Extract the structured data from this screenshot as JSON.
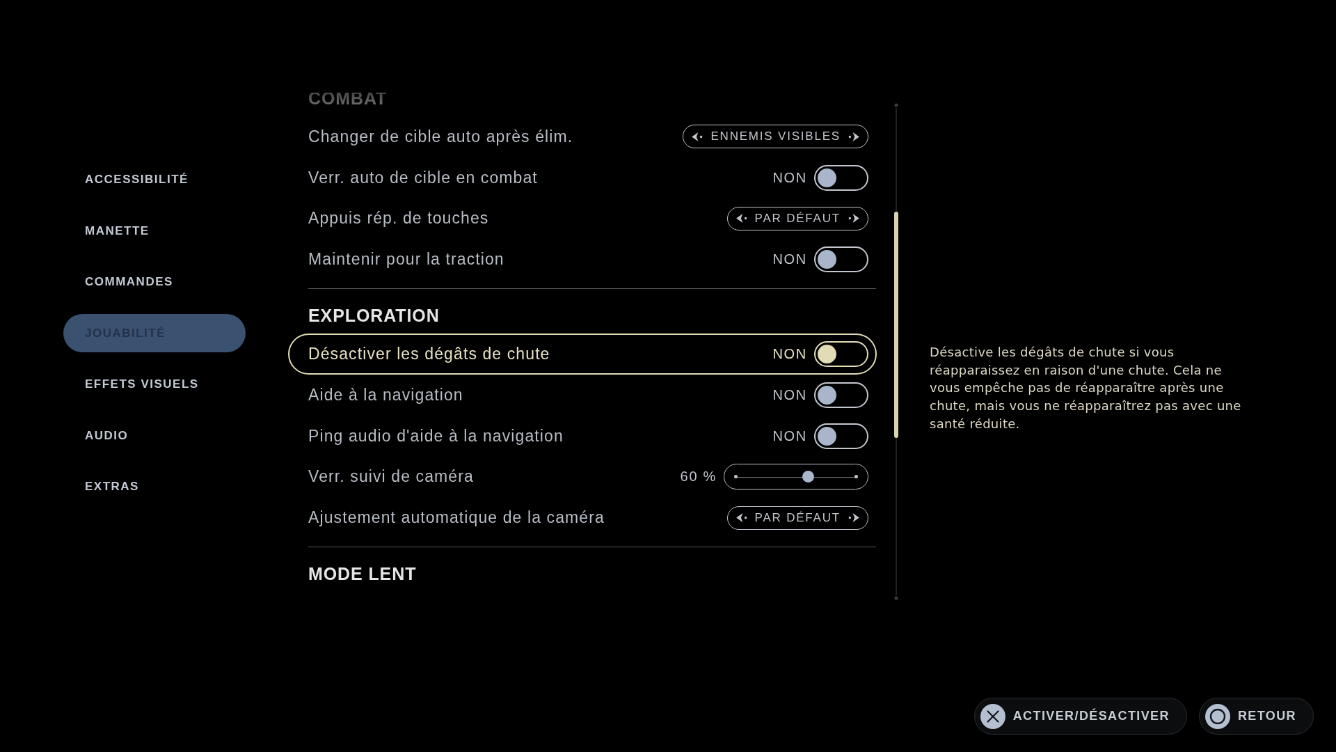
{
  "sidebar": {
    "items": [
      {
        "label": "ACCESSIBILITÉ",
        "selected": false
      },
      {
        "label": "MANETTE",
        "selected": false
      },
      {
        "label": "COMMANDES",
        "selected": false
      },
      {
        "label": "JOUABILITÉ",
        "selected": true
      },
      {
        "label": "EFFETS VISUELS",
        "selected": false
      },
      {
        "label": "AUDIO",
        "selected": false
      },
      {
        "label": "EXTRAS",
        "selected": false
      }
    ]
  },
  "settings": {
    "sections": [
      {
        "title": "COMBAT",
        "rows": [
          {
            "kind": "selector",
            "label": "Changer de cible auto après élim.",
            "value": "ENNEMIS VISIBLES",
            "selected": false
          },
          {
            "kind": "toggle",
            "label": "Verr. auto de cible en combat",
            "value": "NON",
            "on": false,
            "selected": false
          },
          {
            "kind": "selector",
            "label": "Appuis rép. de touches",
            "value": "PAR DÉFAUT",
            "selected": false
          },
          {
            "kind": "toggle",
            "label": "Maintenir pour la traction",
            "value": "NON",
            "on": false,
            "selected": false
          }
        ]
      },
      {
        "title": "EXPLORATION",
        "rows": [
          {
            "kind": "toggle",
            "label": "Désactiver les dégâts de chute",
            "value": "NON",
            "on": false,
            "selected": true
          },
          {
            "kind": "toggle",
            "label": "Aide à la navigation",
            "value": "NON",
            "on": false,
            "selected": false
          },
          {
            "kind": "toggle",
            "label": "Ping audio d'aide à la navigation",
            "value": "NON",
            "on": false,
            "selected": false
          },
          {
            "kind": "slider",
            "label": "Verr. suivi de caméra",
            "value": "60 %",
            "level": 0.6,
            "selected": false
          },
          {
            "kind": "selector",
            "label": "Ajustement automatique de la caméra",
            "value": "PAR DÉFAUT",
            "selected": false
          }
        ]
      },
      {
        "title": "MODE LENT"
      }
    ]
  },
  "description": "Désactive les dégâts de chute si vous réapparaissez en raison d'une chute. Cela ne vous empêche pas de réapparaître après une chute, mais vous ne réapparaîtrez pas avec une santé réduite.",
  "footer": {
    "buttons": [
      {
        "kind": "cross",
        "label": "ACTIVER/DÉSACTIVER"
      },
      {
        "kind": "circle",
        "label": "RETOUR"
      }
    ]
  }
}
